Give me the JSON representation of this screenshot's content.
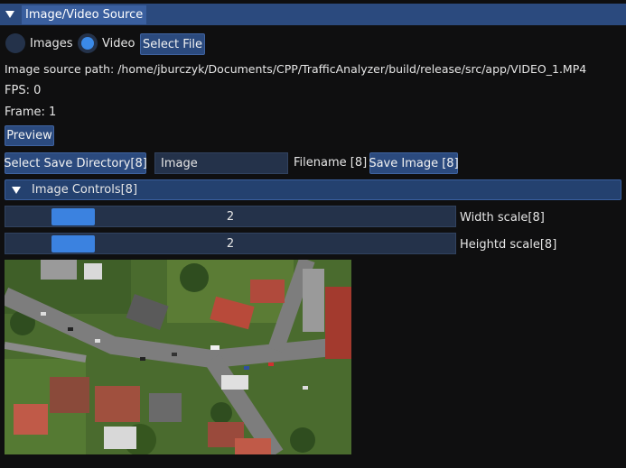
{
  "header": {
    "title": "Image/Video Source"
  },
  "source": {
    "radio_images": "Images",
    "radio_video": "Video",
    "selected": "Video",
    "select_file": "Select File",
    "path_line": "Image source path: /home/jburczyk/Documents/CPP/TrafficAnalyzer/build/release/src/app/VIDEO_1.MP4",
    "fps_line": "FPS: 0",
    "frame_line": "Frame: 1",
    "preview": "Preview"
  },
  "save": {
    "select_dir": "Select Save Directory[8]",
    "filename_value": "Image",
    "filename_label": "Filename [8]",
    "save_image": "Save Image [8]"
  },
  "image_controls": {
    "title": "Image Controls[8]",
    "width_scale": {
      "value": "2",
      "label": "Width scale[8]"
    },
    "height_scale": {
      "value": "2",
      "label": "Heightd scale[8]"
    }
  },
  "colors": {
    "header": "#2b4a7e",
    "button": "#2b4a7e",
    "field": "#24324a",
    "accent": "#3b82e0",
    "background": "#0f0f10"
  }
}
